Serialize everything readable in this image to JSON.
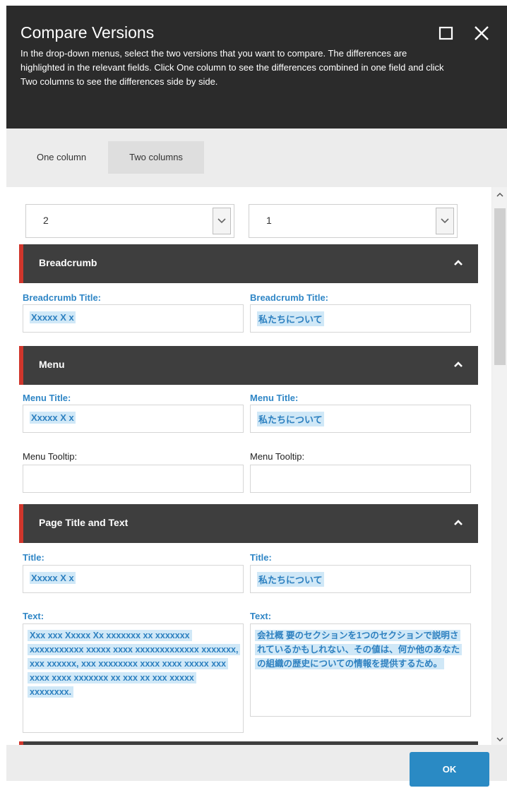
{
  "dialog": {
    "title": "Compare Versions",
    "description": "In the drop-down menus, select the two versions that you want to compare. The differences are highlighted in the relevant fields. Click One column to see the differences combined in one field and click Two columns to see the differences side by side."
  },
  "tabs": {
    "one_column": "One column",
    "two_columns": "Two columns",
    "selected": "Two columns"
  },
  "versions": {
    "left": "2",
    "right": "1"
  },
  "sections": [
    {
      "name": "Breadcrumb",
      "fields": [
        {
          "label": "Breadcrumb Title:",
          "left": "Xxxxx X x",
          "right": "私たちについて",
          "changed": true
        }
      ]
    },
    {
      "name": "Menu",
      "fields": [
        {
          "label": "Menu Title:",
          "left": "Xxxxx X x",
          "right": "私たちについて",
          "changed": true
        },
        {
          "label": "Menu Tooltip:",
          "left": "",
          "right": "",
          "changed": false
        }
      ]
    },
    {
      "name": "Page Title and Text",
      "fields": [
        {
          "label": "Title:",
          "left": "Xxxxx X x",
          "right": "私たちについて",
          "changed": true
        },
        {
          "label": "Text:",
          "left": "Xxx  xxx Xxxxx Xx xxxxxxx xx xxxxxxx xxxxxxxxxxx xxxxx xxxx xxxxxxxxxxxxx xxxxxxx, xxx xxxxxx, xxx xxxxxxxx xxxx xxxx xxxxx xxx xxxx xxxx xxxxxxx xx xxx xx xxx xxxxx xxxxxxxx.",
          "right": "会社概 要のセクションを1つのセクションで説明されているかもしれない、その値は、何か他のあなたの組織の歴史についての情報を提供するため。",
          "changed": true
        }
      ]
    }
  ],
  "buttons": {
    "ok": "OK"
  },
  "colors": {
    "header_bg": "#2b2b2b",
    "section_bg": "#3e3e3e",
    "accent_red": "#d0362c",
    "link_blue": "#2f86c6",
    "highlight": "#d0e8f7",
    "ok_button": "#2a8ac4"
  },
  "icons": {
    "maximize": "maximize-icon",
    "close": "close-icon",
    "collapse": "chevron-up-icon",
    "dropdown": "chevron-down-icon"
  }
}
